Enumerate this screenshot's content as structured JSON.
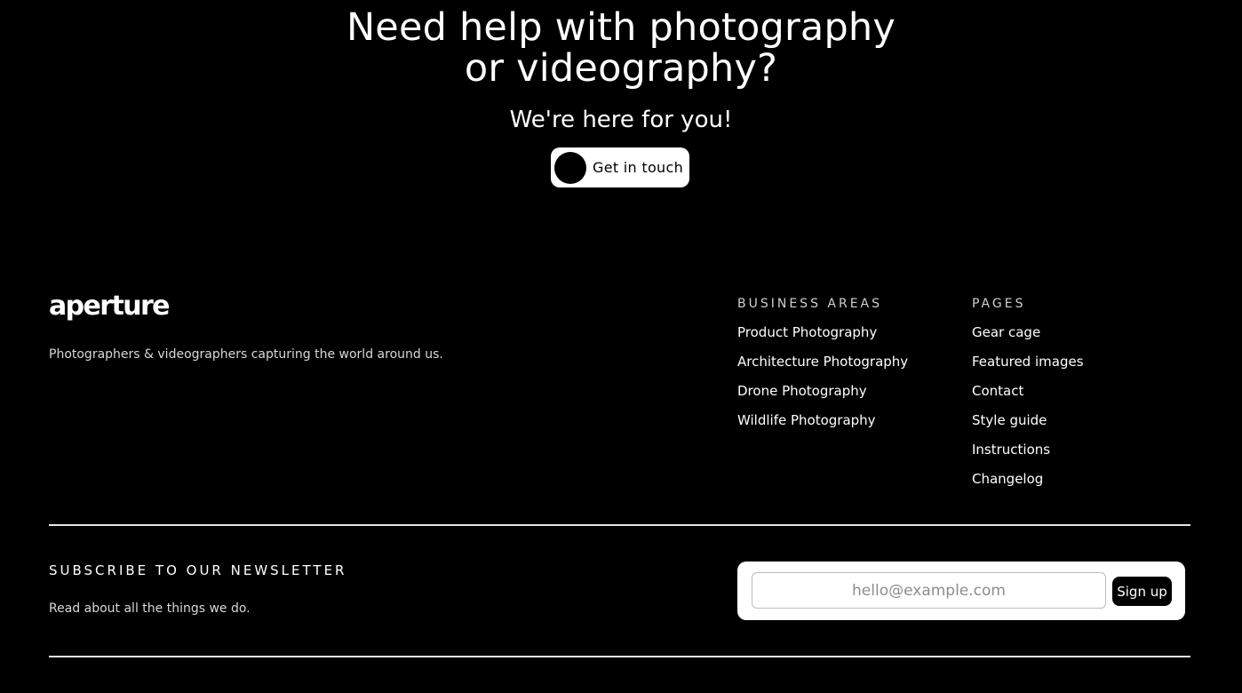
{
  "hero": {
    "title_line1": "Need help with photography",
    "title_line2": "or videography?",
    "subtitle": "We're here for you!",
    "cta_label": "Get in touch"
  },
  "footer": {
    "logo": "aperture",
    "tagline": "Photographers & videographers capturing the world around us.",
    "business_areas": {
      "heading": "BUSINESS AREAS",
      "items": [
        "Product Photography",
        "Architecture Photography",
        "Drone Photography",
        "Wildlife Photography"
      ]
    },
    "pages": {
      "heading": "PAGES",
      "items": [
        "Gear cage",
        "Featured images",
        "Contact",
        "Style guide",
        "Instructions",
        "Changelog"
      ]
    }
  },
  "newsletter": {
    "title": "SUBSCRIBE TO OUR NEWSLETTER",
    "subtitle": "Read about all the things we do.",
    "email_placeholder": "hello@example.com",
    "email_value": "",
    "signup_label": "Sign up"
  }
}
